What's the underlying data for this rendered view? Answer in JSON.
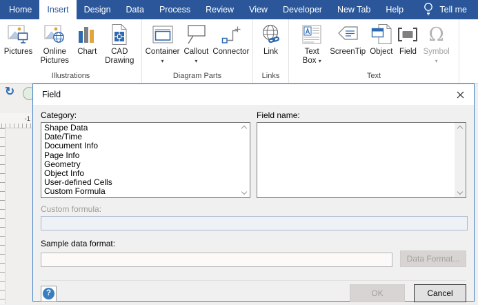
{
  "tabbar": {
    "tabs": [
      {
        "label": "Home",
        "active": false
      },
      {
        "label": "Insert",
        "active": true
      },
      {
        "label": "Design",
        "active": false
      },
      {
        "label": "Data",
        "active": false
      },
      {
        "label": "Process",
        "active": false
      },
      {
        "label": "Review",
        "active": false
      },
      {
        "label": "View",
        "active": false
      },
      {
        "label": "Developer",
        "active": false
      },
      {
        "label": "New Tab",
        "active": false
      },
      {
        "label": "Help",
        "active": false
      }
    ],
    "tell_me_label": "Tell me"
  },
  "ribbon": {
    "groups": [
      {
        "label": "Illustrations",
        "buttons": [
          {
            "label": "Pictures"
          },
          {
            "label": "Online Pictures"
          },
          {
            "label": "Chart"
          },
          {
            "label": "CAD Drawing"
          }
        ]
      },
      {
        "label": "Diagram Parts",
        "buttons": [
          {
            "label": "Container",
            "dropdown": true
          },
          {
            "label": "Callout",
            "dropdown": true
          },
          {
            "label": "Connector"
          }
        ]
      },
      {
        "label": "Links",
        "buttons": [
          {
            "label": "Link"
          }
        ]
      },
      {
        "label": "Text",
        "buttons": [
          {
            "label": "Text Box",
            "dropdown": true
          },
          {
            "label": "ScreenTip"
          },
          {
            "label": "Object"
          },
          {
            "label": "Field"
          },
          {
            "label": "Symbol",
            "dropdown": true,
            "disabled": true
          }
        ]
      }
    ]
  },
  "canvas": {
    "ruler_mark": "-1"
  },
  "dialog": {
    "title": "Field",
    "category_label": "Category:",
    "categories": [
      "Shape Data",
      "Date/Time",
      "Document Info",
      "Page Info",
      "Geometry",
      "Object Info",
      "User-defined Cells",
      "Custom Formula"
    ],
    "field_name_label": "Field name:",
    "custom_formula_label": "Custom formula:",
    "custom_formula_value": "",
    "sample_format_label": "Sample data format:",
    "sample_format_value": "",
    "data_format_button": "Data Format...",
    "ok_button": "OK",
    "cancel_button": "Cancel",
    "help_glyph": "?"
  },
  "icons": {
    "undo_glyph": "↻",
    "dropdown_caret": "▾",
    "symbol_omega": "Ω"
  },
  "colors": {
    "accent": "#2b579a",
    "dialog_border": "#3f80c4",
    "icon_blue": "#2e6ab0",
    "icon_gray": "#7f7f7f",
    "chart_yellow": "#e0a53c",
    "disabled_text": "#a3a19f"
  }
}
